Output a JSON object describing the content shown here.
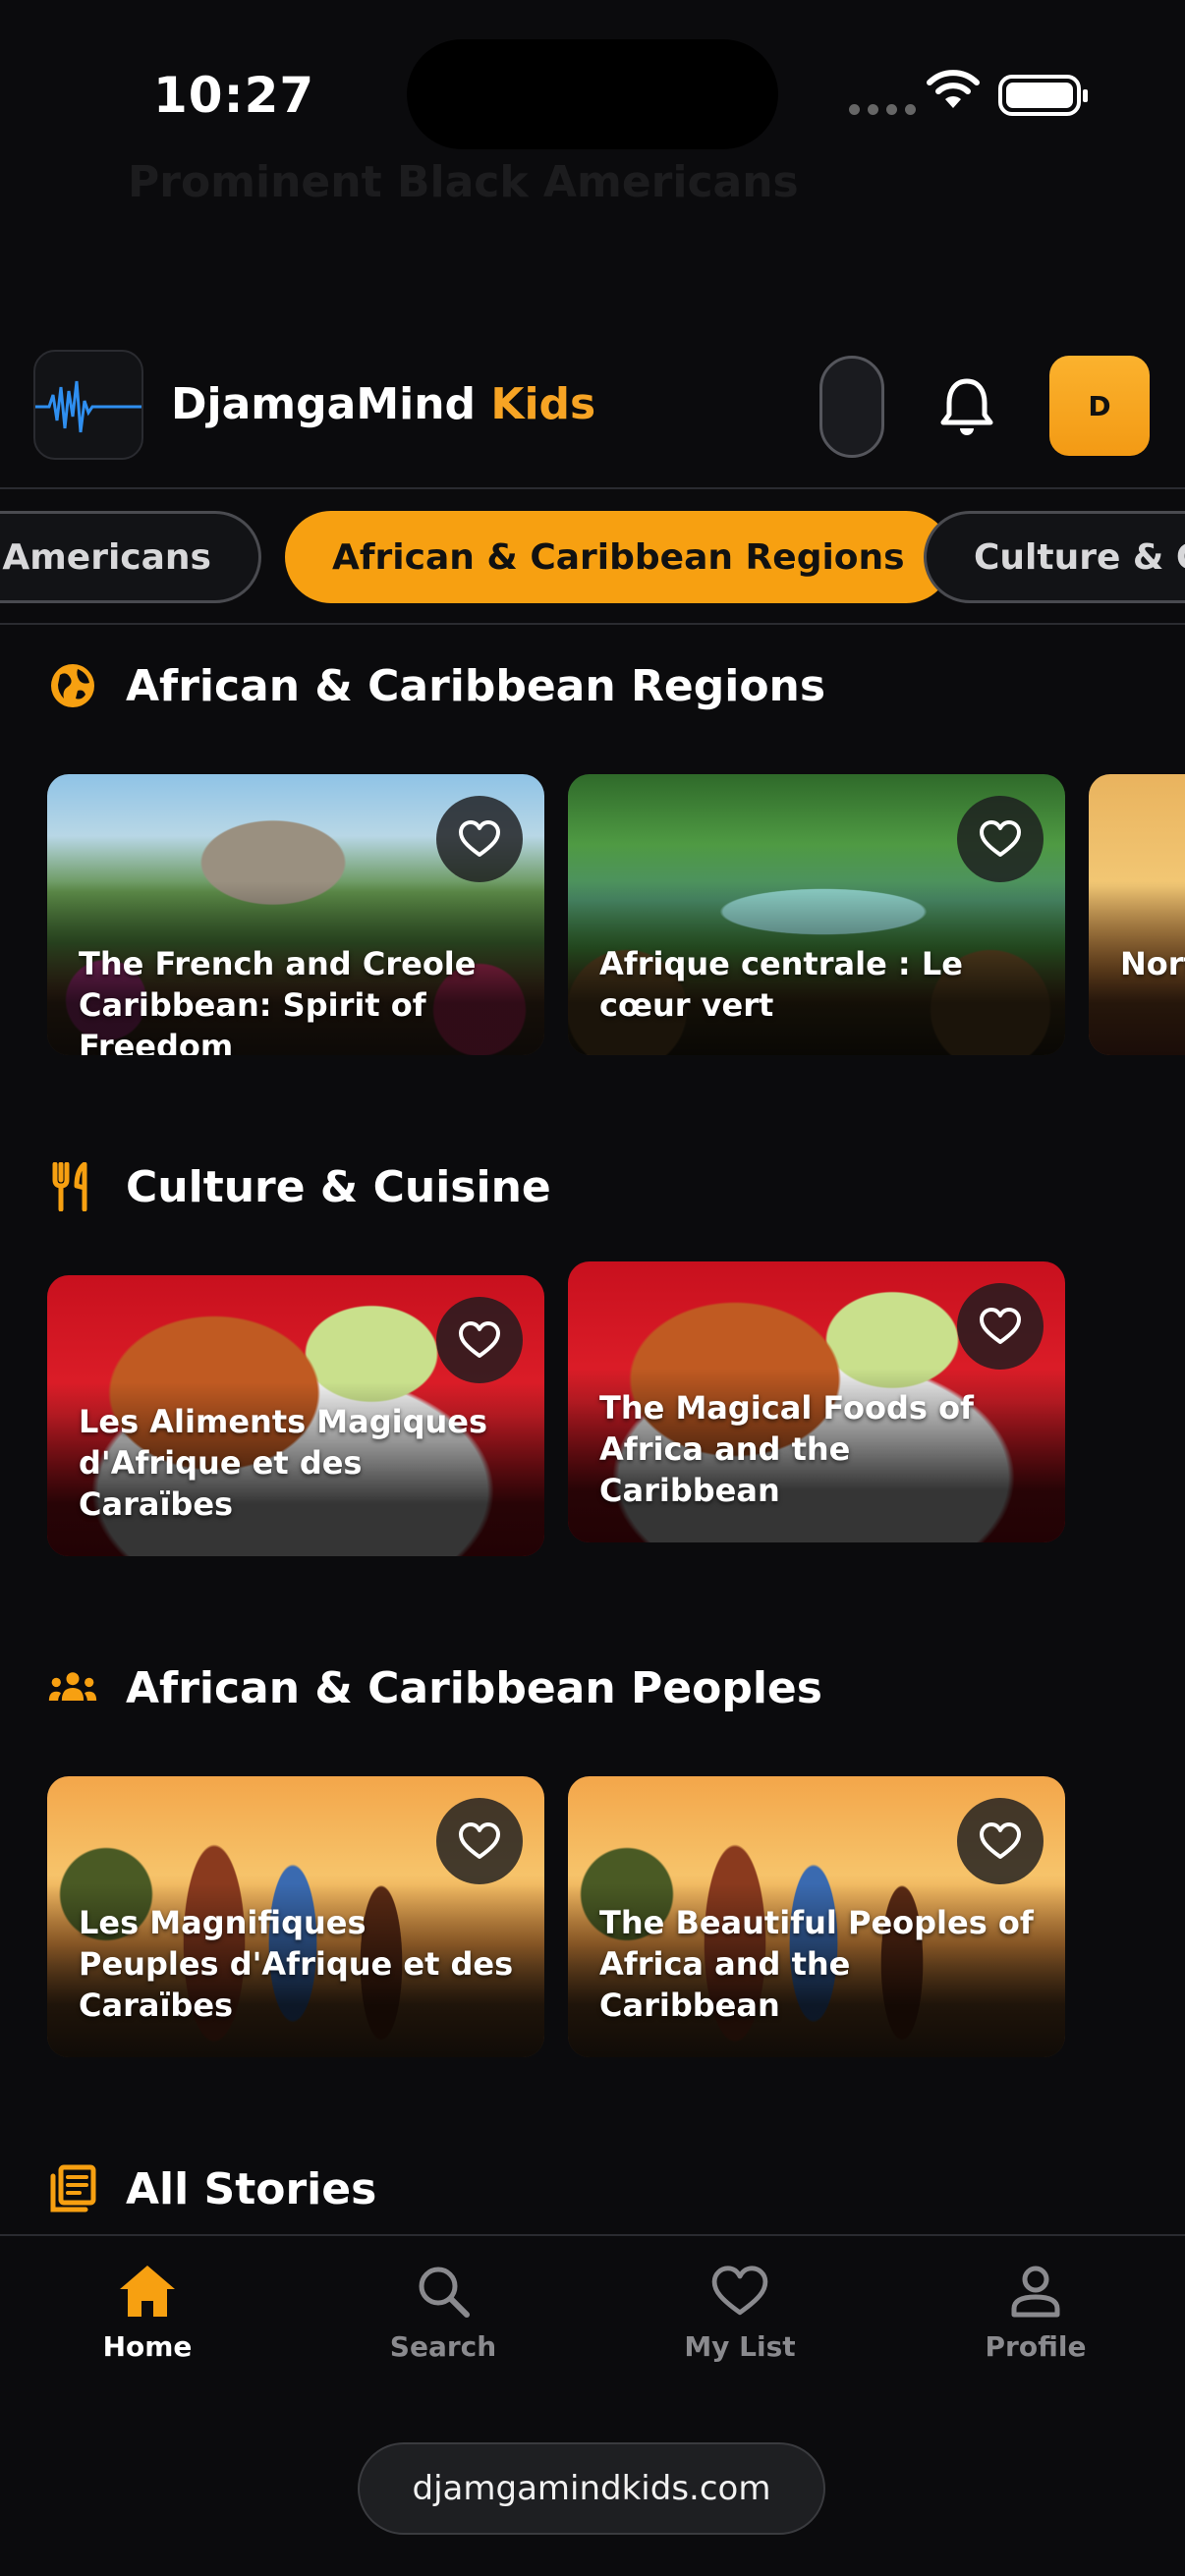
{
  "status": {
    "time": "10:27"
  },
  "ghost_section": {
    "title": "Prominent Black Americans"
  },
  "header": {
    "title_main": "DjamgaMind",
    "title_accent": "Kids",
    "avatar_letter": "D"
  },
  "categories": [
    {
      "label": "Prominent Black Americans",
      "active": false
    },
    {
      "label": "African & Caribbean Regions",
      "active": true
    },
    {
      "label": "Culture & Cuisine",
      "active": false
    }
  ],
  "sections": [
    {
      "title": "African & Caribbean Regions",
      "icon": "globe-icon",
      "cards": [
        {
          "title": "The French and Creole Caribbean: Spirit of Freedom",
          "scene": "citadel"
        },
        {
          "title": "Afrique centrale : Le cœur vert",
          "scene": "river"
        },
        {
          "title": "North African Deserts",
          "scene": "desert"
        }
      ]
    },
    {
      "title": "Culture & Cuisine",
      "icon": "utensils-icon",
      "cards": [
        {
          "title": "Les Aliments Magiques d'Afrique et des Caraïbes",
          "scene": "food"
        },
        {
          "title": "The Magical Foods of Africa and the Caribbean",
          "scene": "food"
        }
      ]
    },
    {
      "title": "African & Caribbean Peoples",
      "icon": "people-icon",
      "cards": [
        {
          "title": "Les Magnifiques Peuples d'Afrique et des Caraïbes",
          "scene": "people"
        },
        {
          "title": "The Beautiful Peoples of Africa and the Caribbean",
          "scene": "people"
        }
      ]
    },
    {
      "title": "All Stories",
      "icon": "library-icon",
      "cards": []
    }
  ],
  "nav": {
    "home": "Home",
    "search": "Search",
    "mylist": "My List",
    "profile": "Profile"
  },
  "browser": {
    "url": "djamgamindkids.com"
  },
  "colors": {
    "accent": "#f7a011",
    "background": "#0b0b0d"
  }
}
